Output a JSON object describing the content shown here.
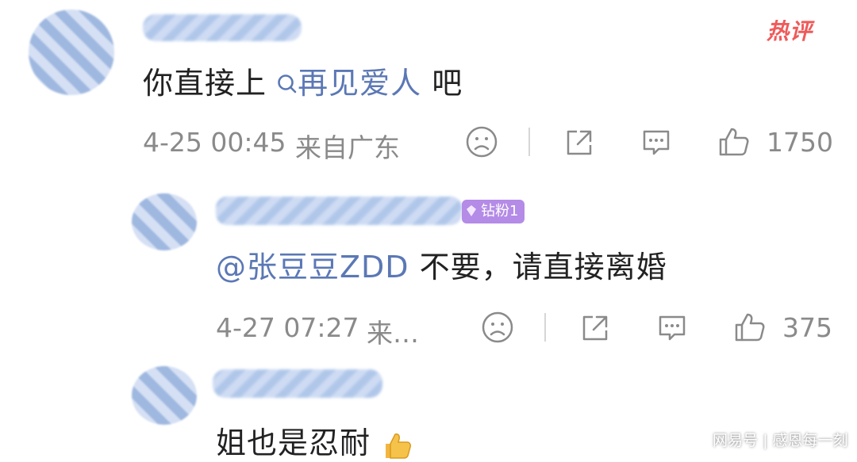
{
  "hot_badge": "热评",
  "comment1": {
    "text_prefix": "你直接上",
    "link_icon": "search-icon",
    "link_text": "再见爱人",
    "text_suffix": "吧",
    "date": "4-25 00:45",
    "location": "来自广东",
    "likes": "1750"
  },
  "reply1": {
    "badge": "钻粉1",
    "mention": "@张豆豆ZDD",
    "text": "不要，请直接离婚",
    "date": "4-27 07:27",
    "location": "来…",
    "likes": "375"
  },
  "reply2": {
    "text": "姐也是忍耐",
    "emoji": "thumbs-up"
  },
  "watermark": {
    "source": "网易号",
    "separator": "|",
    "author": "感恩每一刻"
  },
  "colors": {
    "link": "#5b78b5",
    "hot": "#f05a5a",
    "badge": "#b48be6",
    "meta": "#8a8a8a"
  }
}
